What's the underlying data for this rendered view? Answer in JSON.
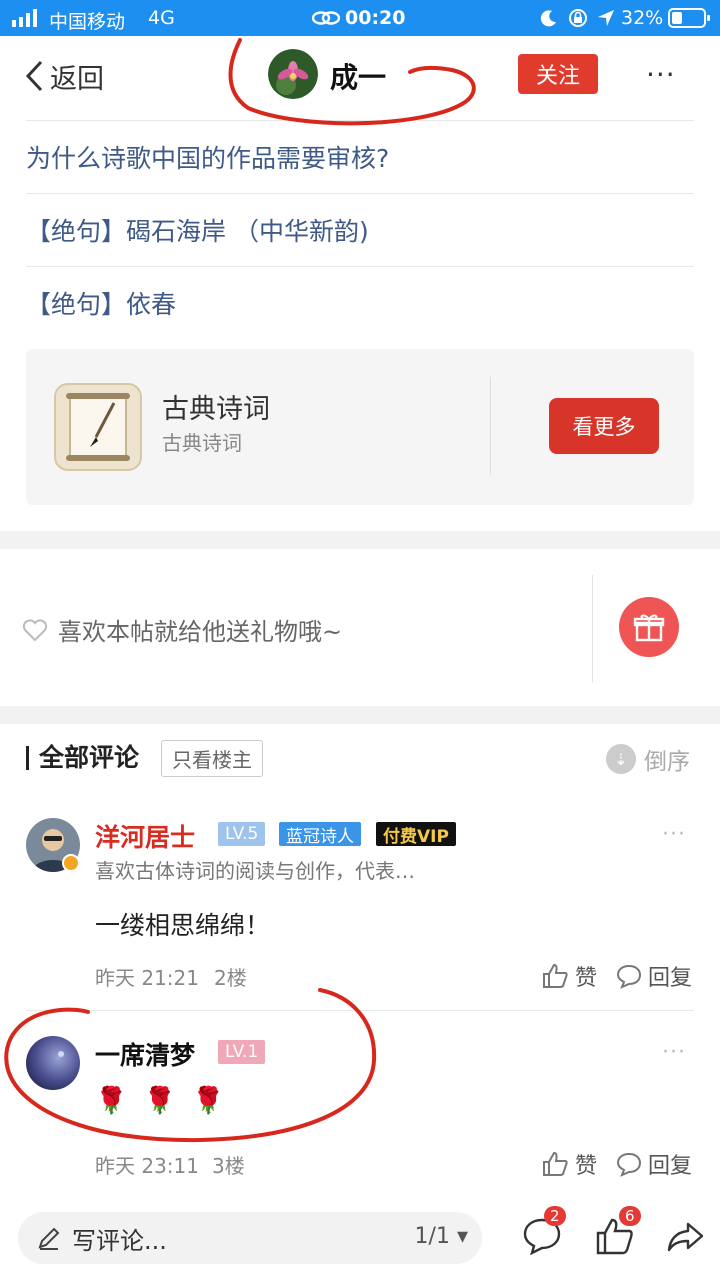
{
  "status_bar": {
    "carrier": "中国移动",
    "network": "4G",
    "time": "00:20",
    "battery": "32%"
  },
  "nav": {
    "back_label": "返回",
    "author": "成一",
    "follow_label": "关注",
    "more": "···"
  },
  "related_links": [
    "为什么诗歌中国的作品需要审核?",
    "【绝句】碣石海岸 （中华新韵)",
    "【绝句】依春"
  ],
  "topic_card": {
    "title": "古典诗词",
    "subtitle": "古典诗词",
    "button": "看更多"
  },
  "gift": {
    "prompt": "喜欢本帖就给他送礼物哦~"
  },
  "comments_header": {
    "title": "全部评论",
    "only_op": "只看楼主",
    "sort": "倒序"
  },
  "comments": [
    {
      "user": "洋河居士",
      "level": "LV.5",
      "badges": [
        "蓝冠诗人",
        "付费VIP"
      ],
      "bio": "喜欢古体诗词的阅读与创作，代表…",
      "content": "一缕相思绵绵！",
      "time": "昨天 21:21",
      "floor": "2楼",
      "like_label": "赞",
      "reply_label": "回复",
      "name_color": "#d82c20"
    },
    {
      "user": "一席清梦",
      "level": "LV.1",
      "content": "🌹 🌹 🌹",
      "time": "昨天 23:11",
      "floor": "3楼",
      "like_label": "赞",
      "reply_label": "回复"
    }
  ],
  "bottom_bar": {
    "placeholder": "写评论...",
    "page": "1/1",
    "comment_count": "2",
    "like_count": "6"
  },
  "colors": {
    "accent_red": "#e03b2c",
    "status_blue": "#1d8ff0",
    "link_blue": "#3f5a86",
    "annotation_red": "#d8281c"
  }
}
